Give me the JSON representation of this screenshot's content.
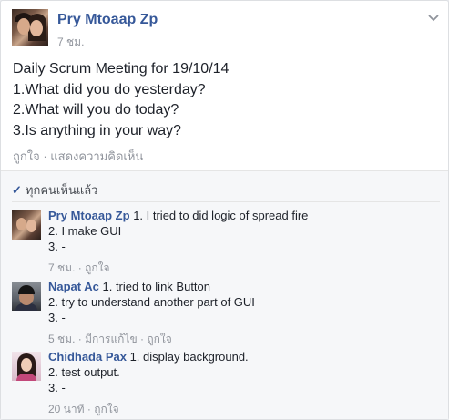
{
  "post": {
    "author": "Pry Mtoaap Zp",
    "time": "7 ชม.",
    "lines": [
      "Daily Scrum Meeting for 19/10/14",
      "1.What did you do yesterday?",
      "2.What will you do today?",
      "3.Is anything in your way?"
    ],
    "like_label": "ถูกใจ",
    "separator": " · ",
    "comment_label": "แสดงความคิดเห็น",
    "chevron_icon": "chevron-down-icon"
  },
  "seen": {
    "check_icon": "check-icon",
    "label": "ทุกคนเห็นแล้ว"
  },
  "comments": [
    {
      "author": "Pry Mtoaap Zp",
      "line1": " 1. I tried to did logic of spread fire",
      "line2": "2. I make GUI",
      "line3": "3. -",
      "time": "7 ชม.",
      "separator": " · ",
      "edited": "",
      "like_label": "ถูกใจ"
    },
    {
      "author": "Napat Ac",
      "line1": " 1. tried to link Button",
      "line2": "2. try to understand another part of GUI",
      "line3": "3. -",
      "time": "5 ชม.",
      "separator": " · ",
      "edited": "มีการแก้ไข",
      "like_label": "ถูกใจ"
    },
    {
      "author": "Chidhada Pax",
      "line1": " 1. display background.",
      "line2": "2. test output.",
      "line3": "3. -",
      "time": "20 นาที",
      "separator": " · ",
      "edited": "",
      "like_label": "ถูกใจ"
    }
  ],
  "colors": {
    "name": "#365899",
    "meta": "#90949c",
    "text": "#1d2129",
    "comments_bg": "#f6f7f9"
  }
}
